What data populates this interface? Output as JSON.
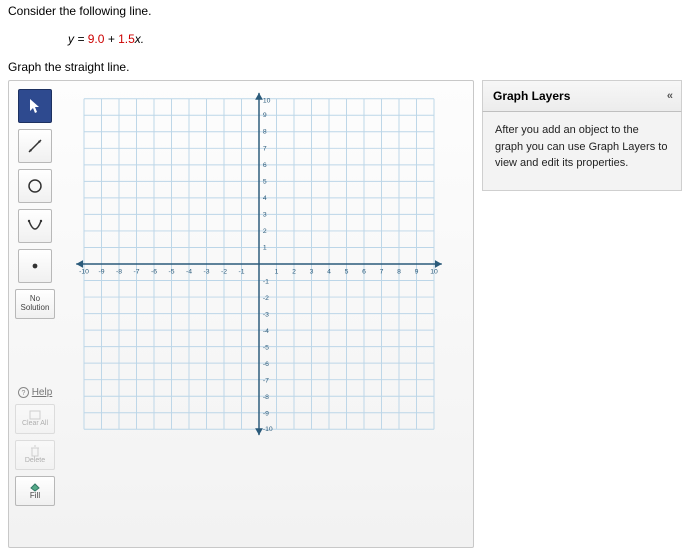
{
  "prompt": "Consider the following line.",
  "equation": {
    "prefix": "y = ",
    "c1": "9.0",
    "mid": " + ",
    "c2": "1.5",
    "suffix": "x.",
    "var": ""
  },
  "instruction": "Graph the straight line.",
  "toolbar": {
    "no_solution": "No\nSolution",
    "help": "Help",
    "clear_all": "Clear All",
    "delete": "Delete",
    "fill": "Fill"
  },
  "graph_layers": {
    "title": "Graph Layers",
    "body": "After you add an object to the graph you can use Graph Layers to view and edit its properties."
  },
  "axes": {
    "x_ticks": [
      "-10",
      "-9",
      "-8",
      "-7",
      "-6",
      "-5",
      "-4",
      "-3",
      "-2",
      "-1",
      "1",
      "2",
      "3",
      "4",
      "5",
      "6",
      "7",
      "8",
      "9",
      "10"
    ],
    "y_ticks_pos": [
      "1",
      "2",
      "3",
      "4",
      "5",
      "6",
      "7",
      "8",
      "9",
      "10"
    ],
    "y_ticks_neg": [
      "-1",
      "-2",
      "-3",
      "-4",
      "-5",
      "-6",
      "-7",
      "-8",
      "-9",
      "-10"
    ]
  },
  "chart_data": {
    "type": "line",
    "title": "",
    "xlabel": "",
    "ylabel": "",
    "x": [],
    "series": [],
    "xlim": [
      -10,
      10
    ],
    "ylim": [
      -10,
      10
    ],
    "grid": true,
    "equation": {
      "slope": 1.5,
      "intercept": 9.0
    }
  }
}
